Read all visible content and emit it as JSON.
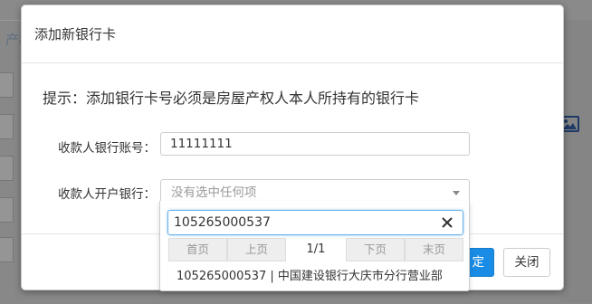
{
  "background": {
    "title_fragment": "产权"
  },
  "modal": {
    "title": "添加新银行卡",
    "hint": "提示：添加银行卡号必须是房屋产权人本人所持有的银行卡",
    "account_label": "收款人银行账号：",
    "account_value": "11111111",
    "bank_label": "收款人开户银行：",
    "bank_placeholder": "没有选中任何项",
    "confirm_label": "定",
    "close_label": "关闭"
  },
  "dropdown": {
    "search_value": "105265000537",
    "pager": {
      "first": "首页",
      "prev": "上页",
      "current": "1/1",
      "next": "下页",
      "last": "末页"
    },
    "options": [
      "105265000537 | 中国建设银行大庆市分行营业部"
    ]
  },
  "icons": {
    "clear": "close-icon",
    "caret": "chevron-down-icon",
    "image": "image-icon"
  }
}
